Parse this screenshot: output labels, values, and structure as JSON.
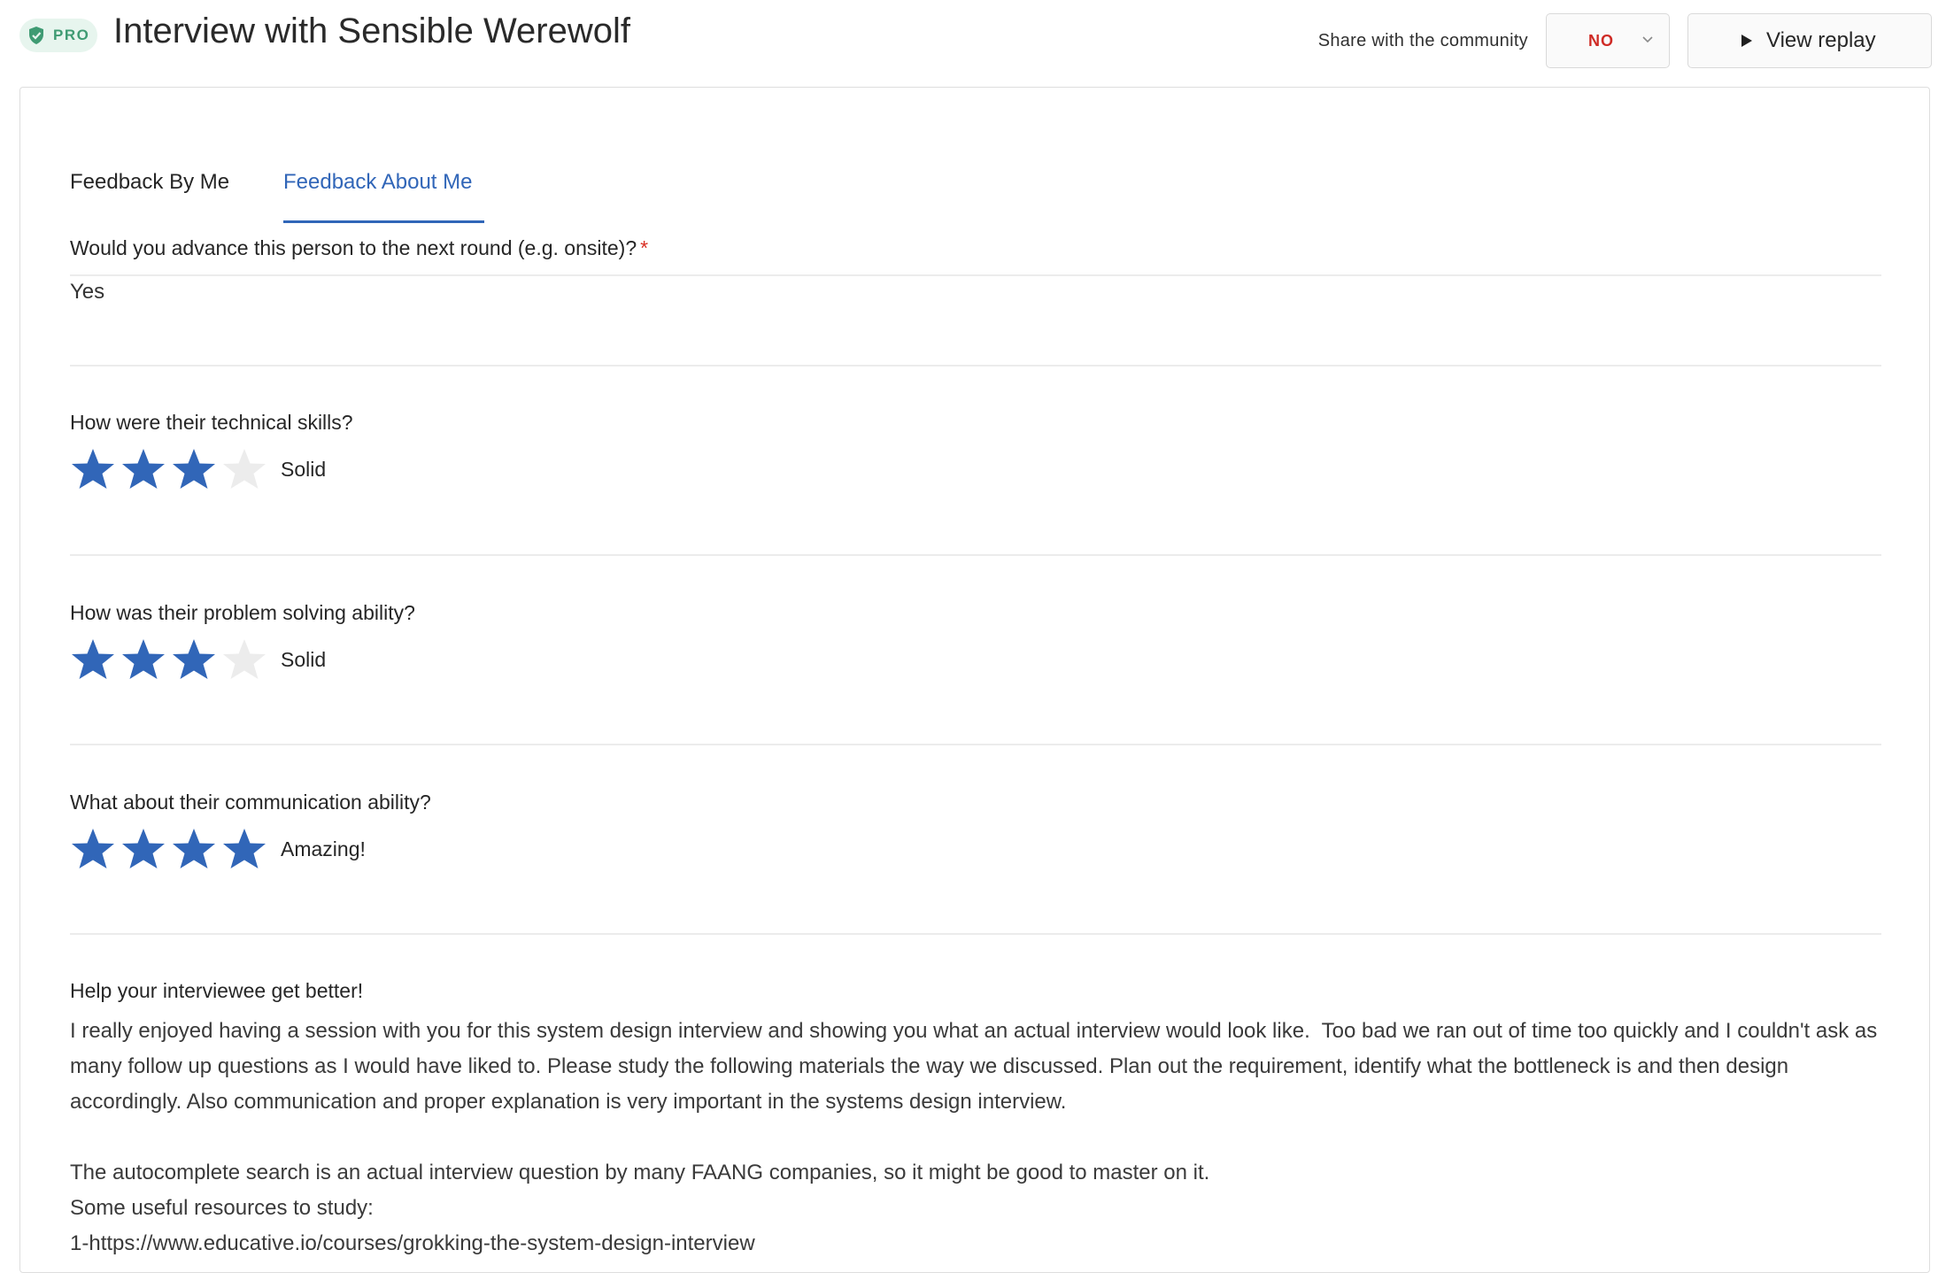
{
  "header": {
    "badge": "PRO",
    "title": "Interview with Sensible Werewolf",
    "share_label": "Share with the community",
    "share_value": "NO",
    "replay_label": "View replay"
  },
  "tabs": [
    {
      "label": "Feedback By Me",
      "active": false
    },
    {
      "label": "Feedback About Me",
      "active": true
    }
  ],
  "questions": {
    "advance": {
      "label": "Would you advance this person to the next round (e.g. onsite)?",
      "required": "*",
      "answer": "Yes"
    },
    "technical": {
      "label": "How were their technical skills?",
      "rating": 3,
      "max": 4,
      "rating_label": "Solid"
    },
    "problem_solving": {
      "label": "How was their problem solving ability?",
      "rating": 3,
      "max": 4,
      "rating_label": "Solid"
    },
    "communication": {
      "label": "What about their communication ability?",
      "rating": 4,
      "max": 4,
      "rating_label": "Amazing!"
    }
  },
  "feedback": {
    "label": "Help your interviewee get better!",
    "p1": "I really enjoyed having a session with you for this system design interview and showing you what an actual interview would look like.  Too bad we ran out of time too quickly and I couldn't ask as many follow up questions as I would have liked to. Please study the following materials the way we discussed. Plan out the requirement, identify what the bottleneck is and then design accordingly. Also communication and proper explanation is very important in the systems design interview.",
    "p2": "The autocomplete search is an actual interview question by many FAANG companies, so it might be good to master on it.",
    "p3": "Some useful resources to study:",
    "p4": "1-https://www.educative.io/courses/grokking-the-system-design-interview"
  },
  "colors": {
    "accent": "#3166b8",
    "star_off": "#ececec",
    "no_red": "#cf2b25",
    "pro_green": "#3f9b73"
  }
}
